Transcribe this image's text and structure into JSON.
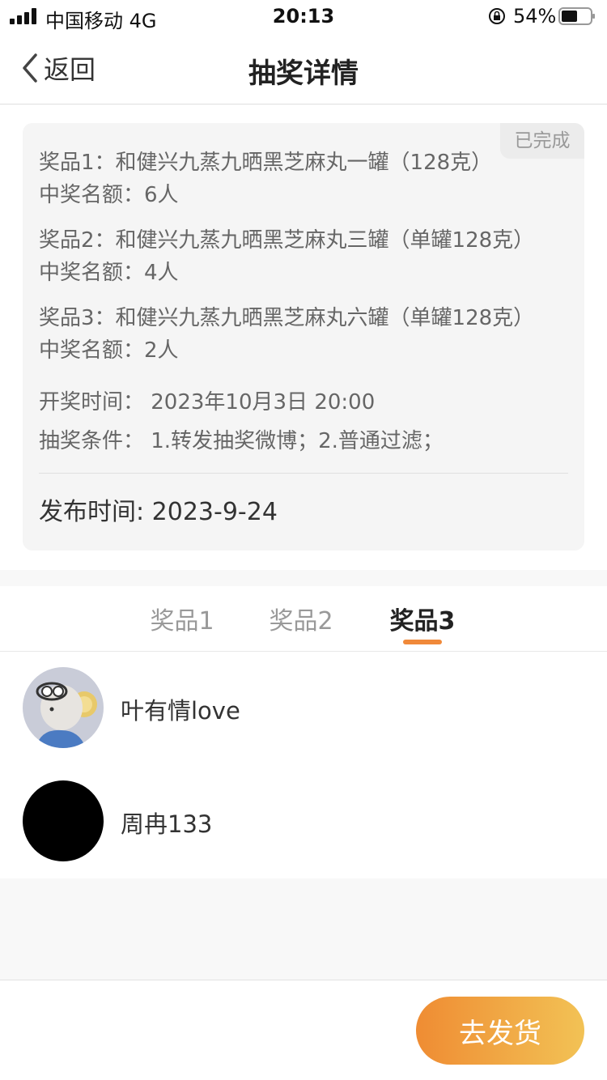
{
  "status_bar": {
    "carrier": "中国移动  4G",
    "time": "20:13",
    "battery": "54%"
  },
  "nav": {
    "back_label": "返回",
    "title": "抽奖详情"
  },
  "card": {
    "status_badge": "已完成",
    "prizes": [
      {
        "name": "奖品1：和健兴九蒸九晒黑芝麻丸一罐（128克）",
        "count": "中奖名额：6人"
      },
      {
        "name": "奖品2：和健兴九蒸九晒黑芝麻丸三罐（单罐128克）",
        "count": "中奖名额：4人"
      },
      {
        "name": "奖品3：和健兴九蒸九晒黑芝麻丸六罐（单罐128克）",
        "count": "中奖名额：2人"
      }
    ],
    "draw_time": "开奖时间： 2023年10月3日 20:00",
    "conditions": "抽奖条件： 1.转发抽奖微博；2.普通过滤；",
    "publish_time": "发布时间: 2023-9-24"
  },
  "tabs": [
    {
      "label": "奖品1"
    },
    {
      "label": "奖品2"
    },
    {
      "label": "奖品3",
      "active": true
    }
  ],
  "winners": [
    {
      "name": "叶有情love",
      "avatar": "cartoon-mouse-avatar"
    },
    {
      "name": "周冉133",
      "avatar": "black-avatar"
    }
  ],
  "bottom": {
    "ship_button": "去发货"
  },
  "colors": {
    "accent": "#f0893a",
    "button_gradient_start": "#ef8c33",
    "button_gradient_end": "#f2c255"
  }
}
